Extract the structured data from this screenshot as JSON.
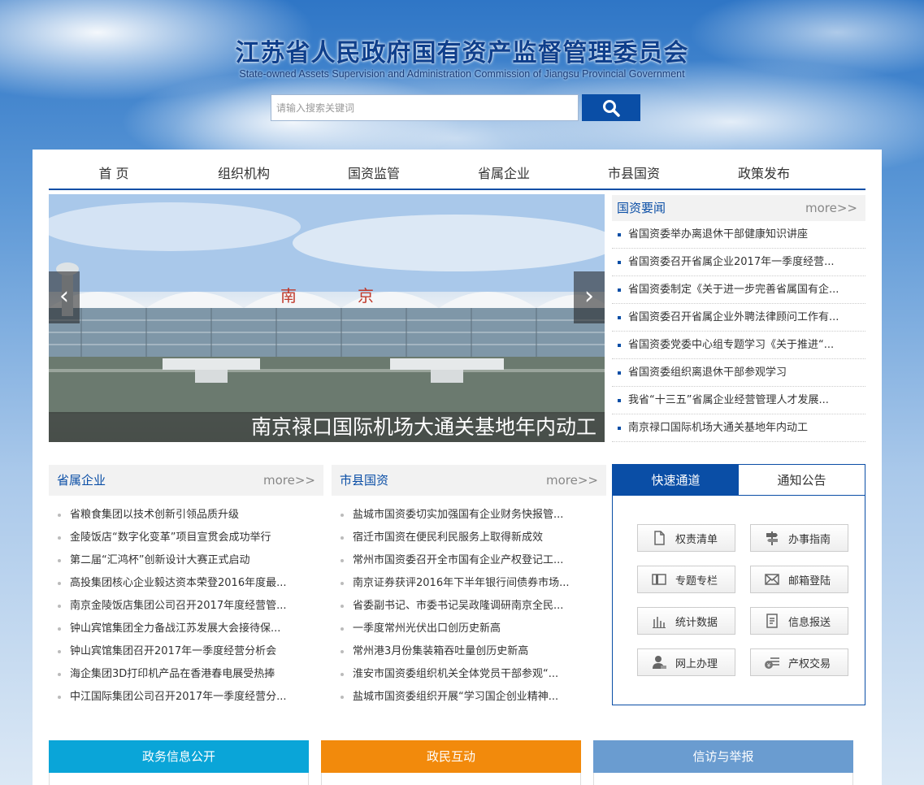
{
  "header": {
    "title": "江苏省人民政府国有资产监督管理委员会",
    "subtitle": "State-owned Assets Supervision and Administration Commission of Jiangsu Provincial Government"
  },
  "search": {
    "placeholder": "请输入搜索关键词",
    "button_icon": "search-icon"
  },
  "nav": {
    "items": [
      "首 页",
      "组织机构",
      "国资监管",
      "省属企业",
      "市县国资",
      "政策发布"
    ]
  },
  "slider": {
    "caption": "南京禄口国际机场大通关基地年内动工",
    "sign_text": [
      "南",
      "京"
    ],
    "prev": "‹",
    "next": "›"
  },
  "news": {
    "title": "国资要闻",
    "more": "more>>",
    "items": [
      "省国资委举办离退休干部健康知识讲座",
      "省国资委召开省属企业2017年一季度经营...",
      "省国资委制定《关于进一步完善省属国有企...",
      "省国资委召开省属企业外聘法律顾问工作有...",
      "省国资委党委中心组专题学习《关于推进“...",
      "省国资委组织离退休干部参观学习",
      "我省“十三五”省属企业经营管理人才发展...",
      "南京禄口国际机场大通关基地年内动工"
    ]
  },
  "provincial": {
    "title": "省属企业",
    "more": "more>>",
    "items": [
      "省粮食集团以技术创新引领品质升级",
      "金陵饭店“数字化变革”项目宣贯会成功举行",
      "第二届“汇鸿杯”创新设计大赛正式启动",
      "高投集团核心企业毅达资本荣登2016年度最...",
      "南京金陵饭店集团公司召开2017年度经营管...",
      "钟山宾馆集团全力备战江苏发展大会接待保...",
      "钟山宾馆集团召开2017年一季度经营分析会",
      "海企集团3D打印机产品在香港春电展受热捧",
      "中江国际集团公司召开2017年一季度经营分..."
    ]
  },
  "municipal": {
    "title": "市县国资",
    "more": "more>>",
    "items": [
      "盐城市国资委切实加强国有企业财务快报管...",
      "宿迁市国资在便民利民服务上取得新成效",
      "常州市国资委召开全市国有企业产权登记工...",
      "南京证券获评2016年下半年银行间债券市场...",
      "省委副书记、市委书记吴政隆调研南京全民...",
      "一季度常州光伏出口创历史新高",
      "常州港3月份集装箱吞吐量创历史新高",
      "淮安市国资委组织机关全体党员干部参观“...",
      "盐城市国资委组织开展“学习国企创业精神..."
    ]
  },
  "quick": {
    "tabs": [
      "快速通道",
      "通知公告"
    ],
    "buttons": [
      {
        "label": "权责清单",
        "icon": "document-icon"
      },
      {
        "label": "办事指南",
        "icon": "signpost-icon"
      },
      {
        "label": "专题专栏",
        "icon": "book-icon"
      },
      {
        "label": "邮箱登陆",
        "icon": "mail-icon"
      },
      {
        "label": "统计数据",
        "icon": "bar-chart-icon"
      },
      {
        "label": "信息报送",
        "icon": "report-icon"
      },
      {
        "label": "网上办理",
        "icon": "user-icon"
      },
      {
        "label": "产权交易",
        "icon": "money-icon"
      }
    ]
  },
  "bottom": {
    "tabs": [
      {
        "label": "政务信息公开",
        "color": "#0aa5d8"
      },
      {
        "label": "政民互动",
        "color": "#f28a0c"
      },
      {
        "label": "信访与举报",
        "color": "#6a9cd0"
      }
    ]
  },
  "colors": {
    "primary": "#0a4ea6",
    "title": "#0f3f8c"
  }
}
